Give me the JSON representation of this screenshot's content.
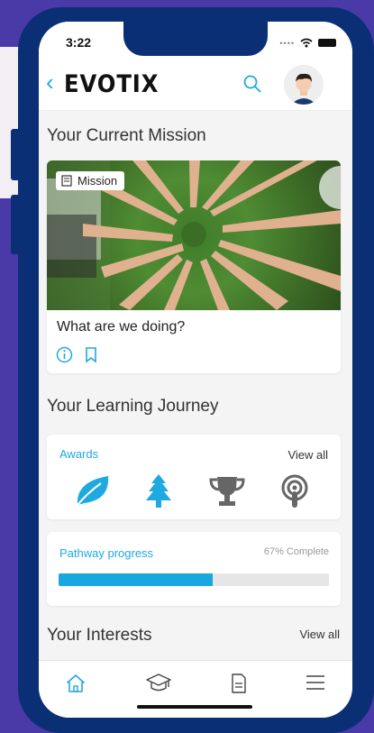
{
  "status": {
    "time": "3:22"
  },
  "header": {
    "logo": "EVOTIX"
  },
  "mission": {
    "section_title": "Your Current Mission",
    "badge_label": "Mission",
    "card_title": "What are we doing?"
  },
  "journey": {
    "section_title": "Your Learning Journey",
    "awards_label": "Awards",
    "awards_view_all": "View all",
    "awards": [
      "leaf-icon",
      "tree-icon",
      "trophy-icon",
      "podcast-icon"
    ],
    "pathway_label": "Pathway progress",
    "pathway_status": "67% Complete",
    "pathway_progress": 0.57
  },
  "interests": {
    "section_title": "Your Interests",
    "view_all": "View all"
  },
  "tabbar": {
    "items": [
      "home-icon",
      "graduation-cap-icon",
      "document-icon",
      "menu-icon"
    ]
  },
  "colors": {
    "accent": "#1fa9e1",
    "phone_frame": "#0b2f75",
    "background": "#4a3aa8",
    "award_active": "#1fa9e1",
    "award_inactive": "#666666"
  }
}
